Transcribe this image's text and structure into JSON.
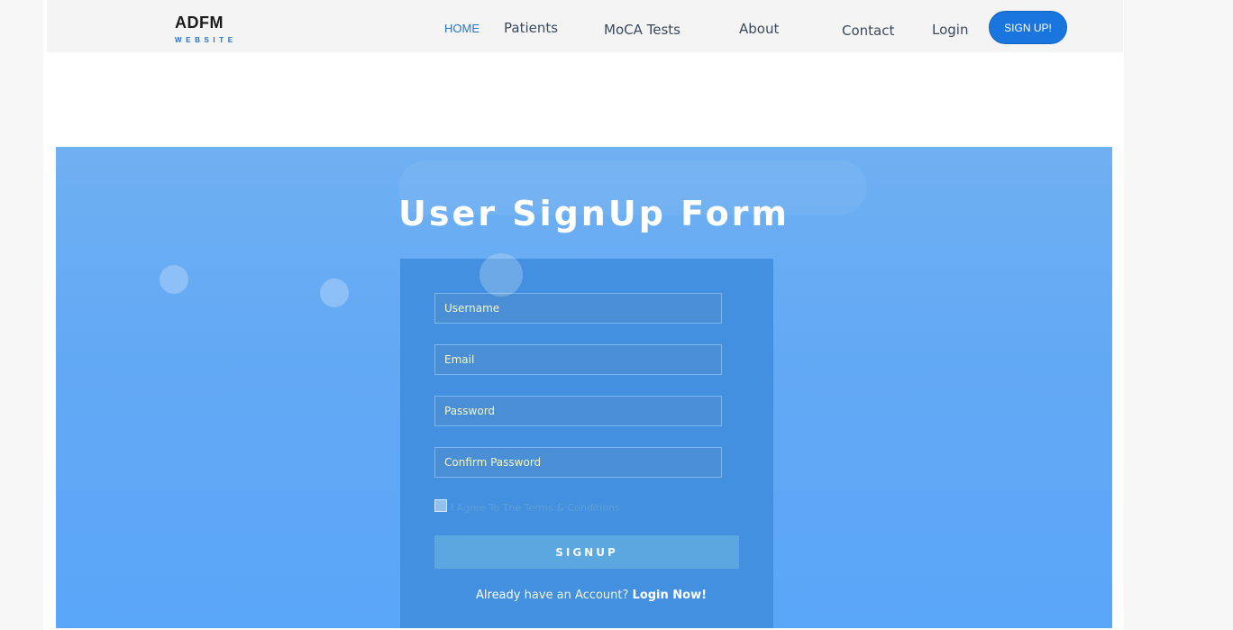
{
  "brand": {
    "name": "ADFM",
    "subtitle": "WEBSITE"
  },
  "nav": {
    "home": "HOME",
    "patients": "Patients",
    "moca": "MoCA Tests",
    "about": "About",
    "contact": "Contact",
    "login": "Login",
    "signup": "SIGN UP!"
  },
  "form": {
    "title": "User SignUp Form",
    "username_placeholder": "Username",
    "email_placeholder": "Email",
    "password_placeholder": "Password",
    "confirm_placeholder": "Confirm Password",
    "agree_label": "I Agree To The Terms & Conditions",
    "submit_label": "SIGNUP",
    "already": "Already",
    "have_account": "have an Account?",
    "login_now": "Login Now!"
  },
  "colors": {
    "accent": "#1a76de",
    "hero_bg": "#63a9f4",
    "panel_bg": "#4490e0"
  }
}
